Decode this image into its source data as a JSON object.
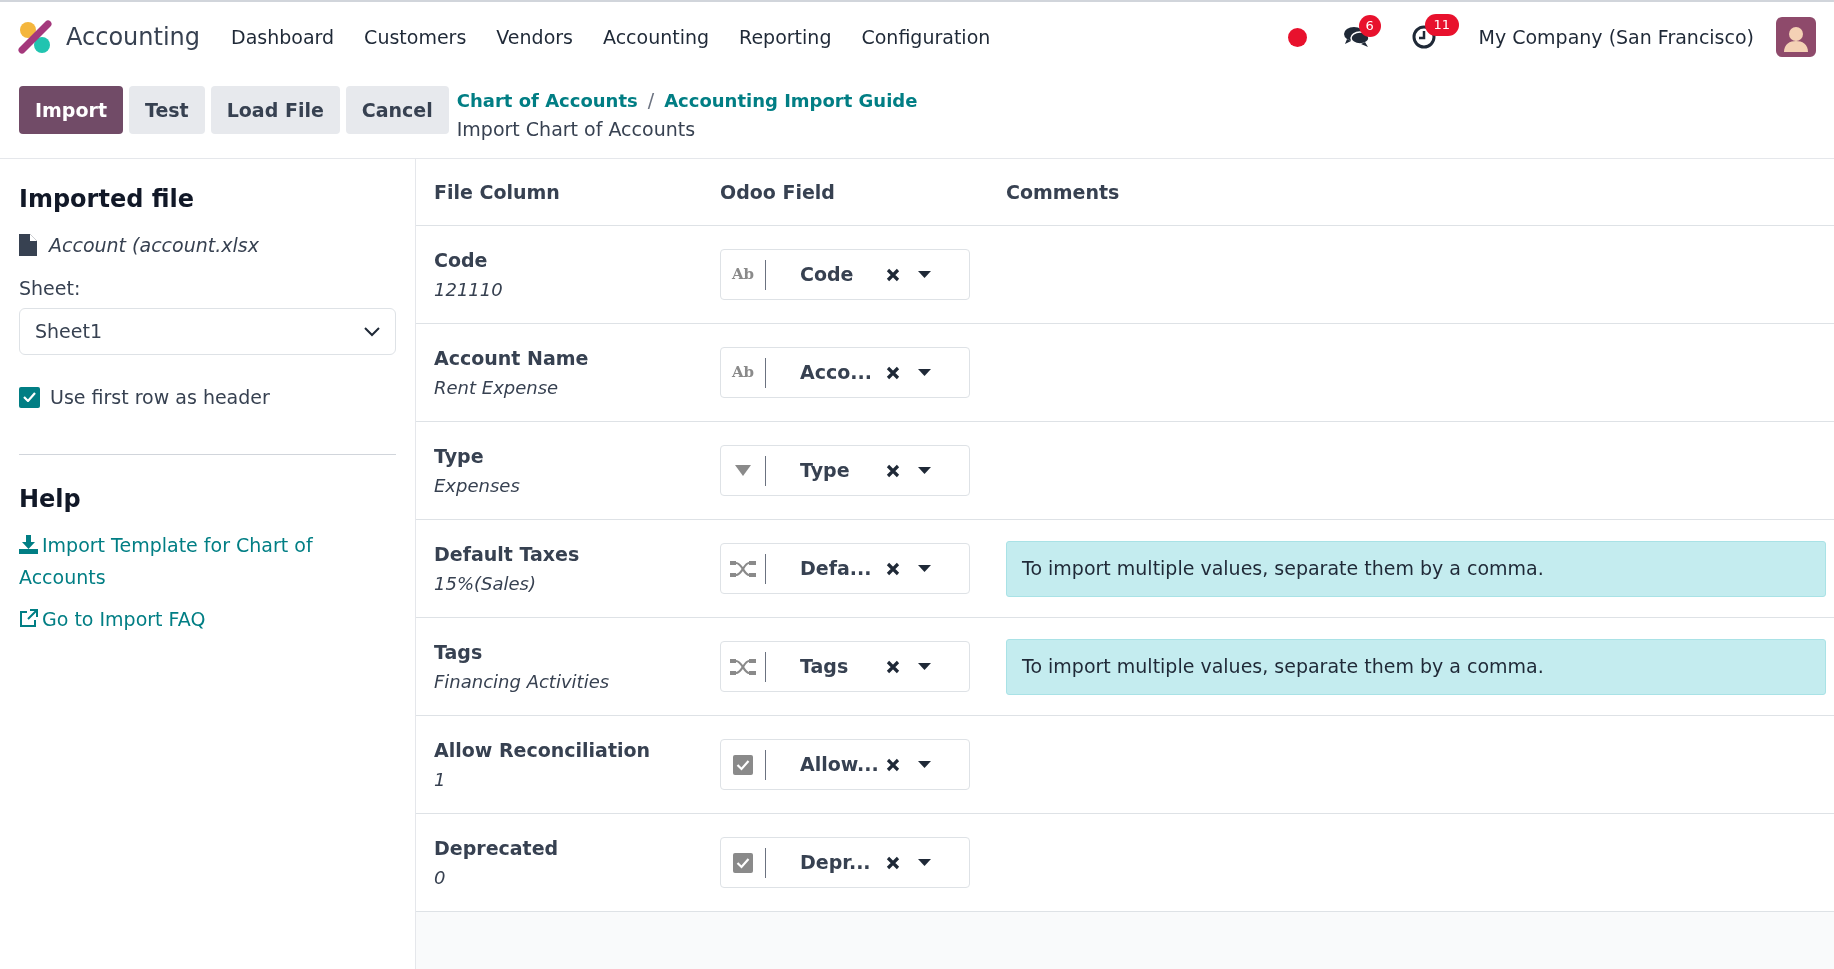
{
  "navbar": {
    "app_name": "Accounting",
    "menu": [
      "Dashboard",
      "Customers",
      "Vendors",
      "Accounting",
      "Reporting",
      "Configuration"
    ],
    "messages_count": "6",
    "activities_count": "11",
    "company": "My Company (San Francisco)"
  },
  "control_panel": {
    "buttons": [
      {
        "label": "Import",
        "primary": true
      },
      {
        "label": "Test",
        "primary": false
      },
      {
        "label": "Load File",
        "primary": false
      },
      {
        "label": "Cancel",
        "primary": false
      }
    ],
    "breadcrumbs": [
      "Chart of Accounts",
      "Accounting Import Guide"
    ],
    "breadcrumb_separator": "/",
    "current": "Import Chart of Accounts"
  },
  "sidebar": {
    "title": "Imported file",
    "file_name": "Account (account.xlsx",
    "sheet_label": "Sheet:",
    "sheet_value": "Sheet1",
    "header_option": {
      "label": "Use first row as header",
      "checked": true
    },
    "help_title": "Help",
    "links": [
      {
        "kind": "download",
        "label": "Import Template for Chart of Accounts"
      },
      {
        "kind": "external",
        "label": "Go to Import FAQ"
      }
    ]
  },
  "table": {
    "columns": [
      "File Column",
      "Odoo Field",
      "Comments"
    ],
    "rows": [
      {
        "column": "Code",
        "sample": "121110",
        "field": "Code",
        "kind": "text",
        "type_label": "Ab"
      },
      {
        "column": "Account Name",
        "sample": "Rent Expense",
        "field": "Acco...",
        "kind": "text",
        "type_label": "Ab"
      },
      {
        "column": "Type",
        "sample": "Expenses",
        "field": "Type",
        "kind": "selection"
      },
      {
        "column": "Default Taxes",
        "sample": "15%(Sales)",
        "field": "Defa...",
        "kind": "relation",
        "comment": "To import multiple values, separate them by a comma."
      },
      {
        "column": "Tags",
        "sample": "Financing Activities",
        "field": "Tags",
        "kind": "relation",
        "comment": "To import multiple values, separate them by a comma."
      },
      {
        "column": "Allow Reconciliation",
        "sample": "1",
        "field": "Allow...",
        "kind": "boolean"
      },
      {
        "column": "Deprecated",
        "sample": "0",
        "field": "Depr...",
        "kind": "boolean"
      }
    ]
  }
}
